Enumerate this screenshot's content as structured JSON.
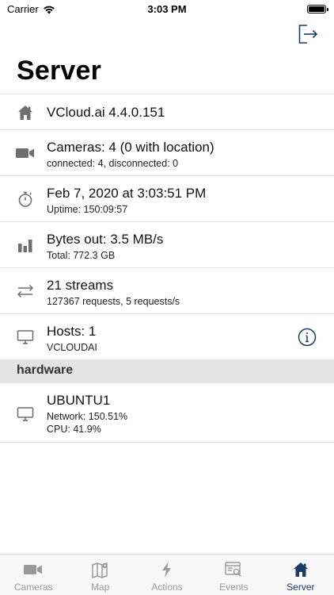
{
  "status_bar": {
    "carrier": "Carrier",
    "time": "3:03 PM"
  },
  "page": {
    "title": "Server"
  },
  "rows": [
    {
      "icon": "home-icon",
      "primary": "VCloud.ai 4.4.0.151"
    },
    {
      "icon": "video-camera-icon",
      "primary": "Cameras: 4 (0 with location)",
      "secondary": "connected: 4, disconnected: 0"
    },
    {
      "icon": "stopwatch-icon",
      "primary": "Feb 7, 2020 at 3:03:51 PM",
      "secondary": "Uptime: 150:09:57"
    },
    {
      "icon": "bar-chart-icon",
      "primary": "Bytes out: 3.5 MB/s",
      "secondary": "Total: 772.3 GB"
    },
    {
      "icon": "arrows-left-right-icon",
      "primary": "21 streams",
      "secondary": "127367 requests, 5 requests/s"
    },
    {
      "icon": "monitor-icon",
      "primary": "Hosts: 1",
      "secondary": "VCLOUDAI"
    }
  ],
  "hardware": {
    "header": "hardware",
    "items": [
      {
        "icon": "monitor-icon",
        "primary": "UBUNTU1",
        "line1": "Network: 150.51%",
        "line2": "CPU: 41.9%"
      }
    ]
  },
  "tabs": [
    {
      "label": "Cameras",
      "icon": "video-camera-icon",
      "active": false
    },
    {
      "label": "Map",
      "icon": "map-pin-icon",
      "active": false
    },
    {
      "label": "Actions",
      "icon": "lightning-icon",
      "active": false
    },
    {
      "label": "Events",
      "icon": "events-search-icon",
      "active": false
    },
    {
      "label": "Server",
      "icon": "home-icon",
      "active": true
    }
  ],
  "colors": {
    "accent": "#1d3b68",
    "icon_gray": "#6f6f6f",
    "tab_inactive": "#9a9a9a",
    "section_bg": "#e4e4e4"
  }
}
